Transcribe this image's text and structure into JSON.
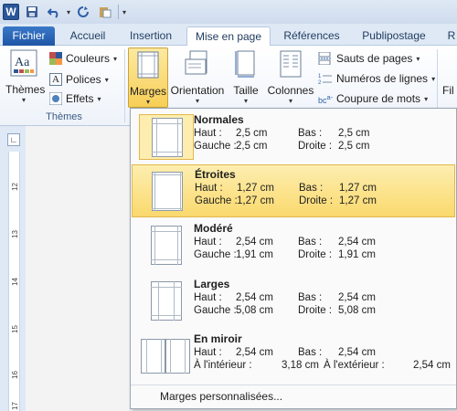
{
  "qat": {
    "logo": "W",
    "icons": [
      "save-icon",
      "undo-icon",
      "redo-icon",
      "paste-icon",
      "customize-icon"
    ]
  },
  "tabs": [
    "Fichier",
    "Accueil",
    "Insertion",
    "Mise en page",
    "Références",
    "Publipostage",
    "R"
  ],
  "ribbon": {
    "themes": {
      "label": "Thèmes",
      "group": "Thèmes",
      "couleurs": "Couleurs",
      "polices": "Polices",
      "effets": "Effets"
    },
    "marges": "Marges",
    "orientation": "Orientation",
    "taille": "Taille",
    "colonnes": "Colonnes",
    "sauts": "Sauts de pages",
    "numeros": "Numéros de lignes",
    "coupure": "Coupure de mots",
    "cut_label": "Fil"
  },
  "ruler_numbers": [
    "12",
    "13",
    "14",
    "15",
    "16",
    "17"
  ],
  "dropdown": {
    "items": [
      {
        "name": "Normales",
        "l1a": "Haut :",
        "l1b": "2,5 cm",
        "l1c": "Bas :",
        "l1d": "2,5 cm",
        "l2a": "Gauche :",
        "l2b": "2,5 cm",
        "l2c": "Droite :",
        "l2d": "2,5 cm"
      },
      {
        "name": "Étroites",
        "l1a": "Haut :",
        "l1b": "1,27 cm",
        "l1c": "Bas :",
        "l1d": "1,27 cm",
        "l2a": "Gauche :",
        "l2b": "1,27 cm",
        "l2c": "Droite :",
        "l2d": "1,27 cm"
      },
      {
        "name": "Modéré",
        "l1a": "Haut :",
        "l1b": "2,54 cm",
        "l1c": "Bas :",
        "l1d": "2,54 cm",
        "l2a": "Gauche :",
        "l2b": "1,91 cm",
        "l2c": "Droite :",
        "l2d": "1,91 cm"
      },
      {
        "name": "Larges",
        "l1a": "Haut :",
        "l1b": "2,54 cm",
        "l1c": "Bas :",
        "l1d": "2,54 cm",
        "l2a": "Gauche :",
        "l2b": "5,08 cm",
        "l2c": "Droite :",
        "l2d": "5,08 cm"
      },
      {
        "name": "En miroir",
        "l1a": "Haut :",
        "l1b": "2,54 cm",
        "l1c": "Bas :",
        "l1d": "2,54 cm",
        "l2a": "À l'intérieur :",
        "l2b": "3,18 cm",
        "l2c": "À l'extérieur :",
        "l2d": "2,54 cm"
      }
    ],
    "custom": "Marges personnalisées..."
  }
}
